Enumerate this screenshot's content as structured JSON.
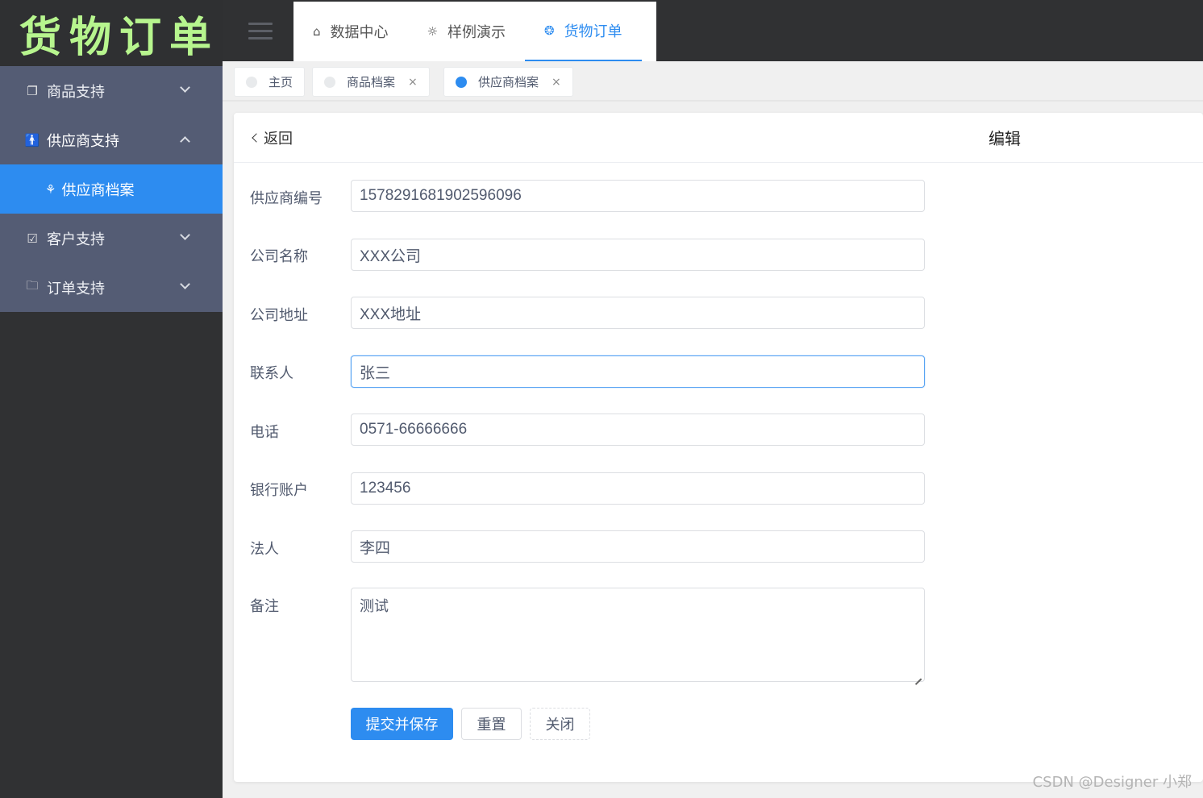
{
  "app": {
    "logo_text": "货物订单"
  },
  "sidebar": {
    "items": [
      {
        "label": "商品支持",
        "icon": "copy-icon"
      },
      {
        "label": "供应商支持",
        "icon": "person-icon"
      },
      {
        "label": "客户支持",
        "icon": "checkbox-icon"
      },
      {
        "label": "订单支持",
        "icon": "folder-icon"
      }
    ],
    "subitem": {
      "label": "供应商档案",
      "icon": "link-icon"
    }
  },
  "topnav": {
    "tabs": [
      {
        "label": "数据中心",
        "icon": "home-icon"
      },
      {
        "label": "样例演示",
        "icon": "bulb-icon"
      },
      {
        "label": "货物订单",
        "icon": "aperture-icon"
      }
    ]
  },
  "page_tabs": [
    {
      "label": "主页"
    },
    {
      "label": "商品档案",
      "close": "×"
    },
    {
      "label": "供应商档案",
      "close": "×"
    }
  ],
  "header": {
    "back_label": "返回",
    "title": "编辑"
  },
  "form": {
    "fields": [
      {
        "label": "供应商编号",
        "value": "1578291681902596096"
      },
      {
        "label": "公司名称",
        "value": "XXX公司"
      },
      {
        "label": "公司地址",
        "value": "XXX地址"
      },
      {
        "label": "联系人",
        "value": "张三"
      },
      {
        "label": "电话",
        "value": "0571-66666666"
      },
      {
        "label": "银行账户",
        "value": "123456"
      },
      {
        "label": "法人",
        "value": "李四"
      },
      {
        "label": "备注",
        "value": "测试"
      }
    ],
    "submit_label": "提交并保存",
    "reset_label": "重置",
    "close_label": "关闭"
  },
  "watermark": "CSDN @Designer 小郑",
  "colors": {
    "accent": "#2d8cf0",
    "sidebar_menu": "#545c74",
    "dark": "#303133",
    "logo": "#b7f58e"
  }
}
